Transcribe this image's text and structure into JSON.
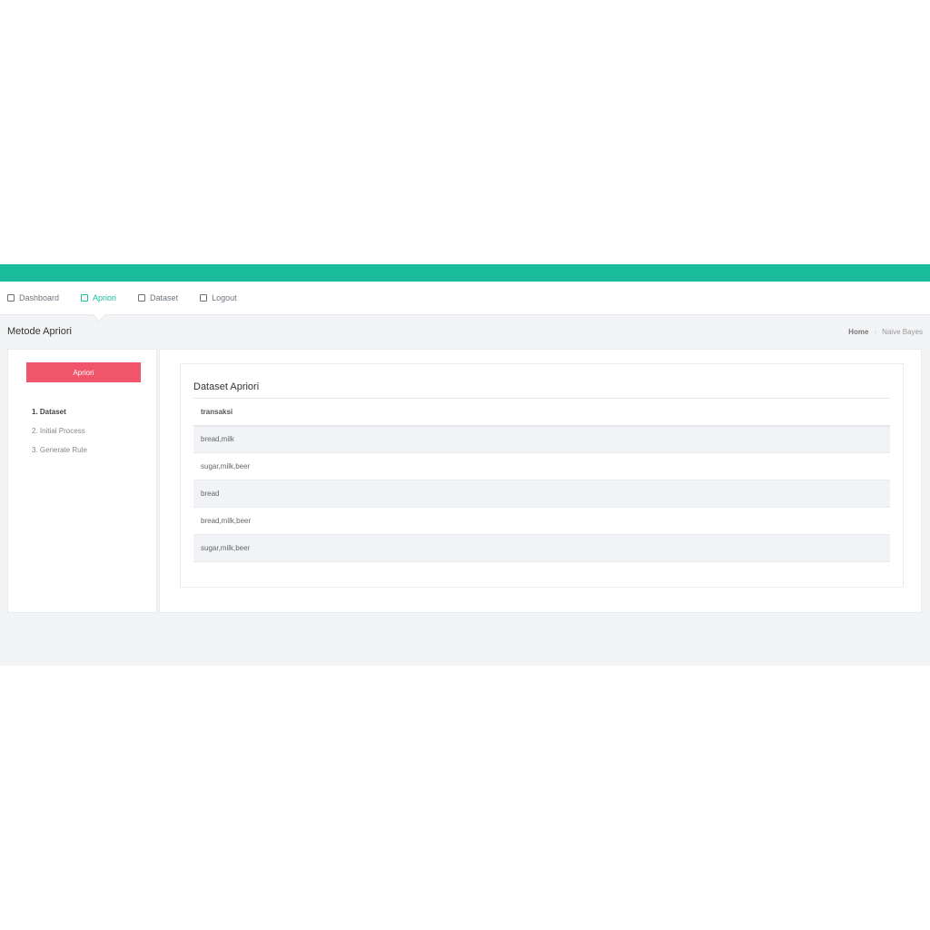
{
  "nav": {
    "items": [
      {
        "label": "Dashboard",
        "icon": "dashboard-icon"
      },
      {
        "label": "Apriori",
        "icon": "document-icon",
        "active": true
      },
      {
        "label": "Dataset",
        "icon": "document-icon"
      },
      {
        "label": "Logout",
        "icon": "document-icon"
      }
    ]
  },
  "header": {
    "title": "Metode Apriori",
    "breadcrumb": [
      "Home",
      "Naive Bayes"
    ]
  },
  "sidebar": {
    "button": "Apriori",
    "steps": [
      "1. Dataset",
      "2. Initial Process",
      "3. Generate Rule"
    ]
  },
  "card": {
    "title": "Dataset Apriori",
    "column": "transaksi",
    "rows": [
      "bread,milk",
      "sugar,milk,beer",
      "bread",
      "bread,milk,beer",
      "sugar,milk,beer"
    ]
  },
  "colors": {
    "accent": "#1abc9c",
    "button": "#f1556c"
  }
}
